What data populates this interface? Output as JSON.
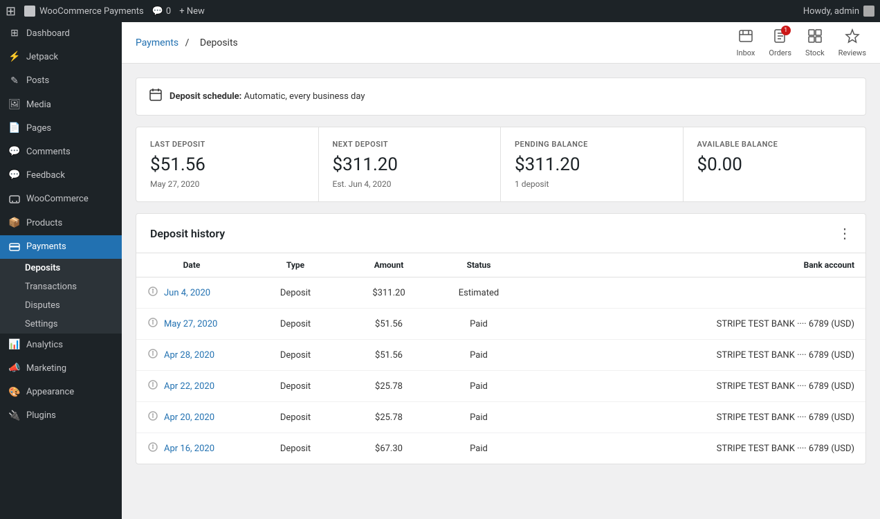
{
  "adminBar": {
    "logo": "W",
    "siteName": "WooCommerce Payments",
    "comments": "0",
    "newLabel": "+ New",
    "howdy": "Howdy, admin"
  },
  "sidebar": {
    "items": [
      {
        "id": "dashboard",
        "label": "Dashboard",
        "icon": "⊞"
      },
      {
        "id": "jetpack",
        "label": "Jetpack",
        "icon": "⚡"
      },
      {
        "id": "posts",
        "label": "Posts",
        "icon": "✎"
      },
      {
        "id": "media",
        "label": "Media",
        "icon": "🖼"
      },
      {
        "id": "pages",
        "label": "Pages",
        "icon": "📄"
      },
      {
        "id": "comments",
        "label": "Comments",
        "icon": "💬"
      },
      {
        "id": "feedback",
        "label": "Feedback",
        "icon": "💬"
      },
      {
        "id": "woocommerce",
        "label": "WooCommerce",
        "icon": "🛒"
      },
      {
        "id": "products",
        "label": "Products",
        "icon": "📦"
      },
      {
        "id": "payments",
        "label": "Payments",
        "icon": "💳",
        "active": true
      }
    ],
    "paymentsSubmenu": [
      {
        "id": "deposits",
        "label": "Deposits",
        "active": true
      },
      {
        "id": "transactions",
        "label": "Transactions"
      },
      {
        "id": "disputes",
        "label": "Disputes"
      },
      {
        "id": "settings",
        "label": "Settings"
      }
    ],
    "bottomItems": [
      {
        "id": "analytics",
        "label": "Analytics",
        "icon": "📊"
      },
      {
        "id": "marketing",
        "label": "Marketing",
        "icon": "📣"
      },
      {
        "id": "appearance",
        "label": "Appearance",
        "icon": "🎨"
      },
      {
        "id": "plugins",
        "label": "Plugins",
        "icon": "🔌"
      }
    ]
  },
  "topHeader": {
    "breadcrumb": {
      "parentLabel": "Payments",
      "currentLabel": "Deposits"
    },
    "actions": [
      {
        "id": "inbox",
        "label": "Inbox",
        "icon": "📥",
        "badge": null
      },
      {
        "id": "orders",
        "label": "Orders",
        "icon": "📋",
        "badge": "1"
      },
      {
        "id": "stock",
        "label": "Stock",
        "icon": "⊞",
        "badge": null
      },
      {
        "id": "reviews",
        "label": "Reviews",
        "icon": "★",
        "badge": null
      }
    ]
  },
  "depositSchedule": {
    "label": "Deposit schedule:",
    "value": "Automatic, every business day"
  },
  "stats": [
    {
      "id": "last-deposit",
      "label": "LAST DEPOSIT",
      "value": "$51.56",
      "sub": "May 27, 2020"
    },
    {
      "id": "next-deposit",
      "label": "NEXT DEPOSIT",
      "value": "$311.20",
      "sub": "Est. Jun 4, 2020"
    },
    {
      "id": "pending-balance",
      "label": "PENDING BALANCE",
      "value": "$311.20",
      "sub": "1 deposit"
    },
    {
      "id": "available-balance",
      "label": "AVAILABLE BALANCE",
      "value": "$0.00",
      "sub": ""
    }
  ],
  "depositHistory": {
    "title": "Deposit history",
    "columns": [
      "Date",
      "Type",
      "Amount",
      "Status",
      "Bank account"
    ],
    "rows": [
      {
        "date": "Jun 4, 2020",
        "type": "Deposit",
        "amount": "$311.20",
        "status": "Estimated",
        "bankAccount": ""
      },
      {
        "date": "May 27, 2020",
        "type": "Deposit",
        "amount": "$51.56",
        "status": "Paid",
        "bankAccount": "STRIPE TEST BANK ···· 6789 (USD)"
      },
      {
        "date": "Apr 28, 2020",
        "type": "Deposit",
        "amount": "$51.56",
        "status": "Paid",
        "bankAccount": "STRIPE TEST BANK ···· 6789 (USD)"
      },
      {
        "date": "Apr 22, 2020",
        "type": "Deposit",
        "amount": "$25.78",
        "status": "Paid",
        "bankAccount": "STRIPE TEST BANK ···· 6789 (USD)"
      },
      {
        "date": "Apr 20, 2020",
        "type": "Deposit",
        "amount": "$25.78",
        "status": "Paid",
        "bankAccount": "STRIPE TEST BANK ···· 6789 (USD)"
      },
      {
        "date": "Apr 16, 2020",
        "type": "Deposit",
        "amount": "$67.30",
        "status": "Paid",
        "bankAccount": "STRIPE TEST BANK ···· 6789 (USD)"
      }
    ]
  }
}
